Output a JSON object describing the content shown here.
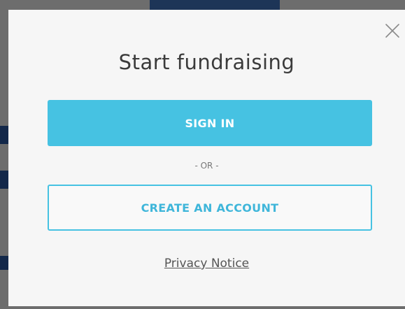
{
  "modal": {
    "title": "Start fundraising",
    "sign_in_label": "SIGN IN",
    "or_label": "- OR -",
    "create_account_label": "CREATE AN ACCOUNT",
    "privacy_label": "Privacy Notice",
    "close_icon": "close-icon"
  },
  "colors": {
    "accent": "#46c2e2",
    "backdrop": "#6d6d6d",
    "modal_background": "#f6f6f6",
    "title_text": "#3b3b3b"
  }
}
